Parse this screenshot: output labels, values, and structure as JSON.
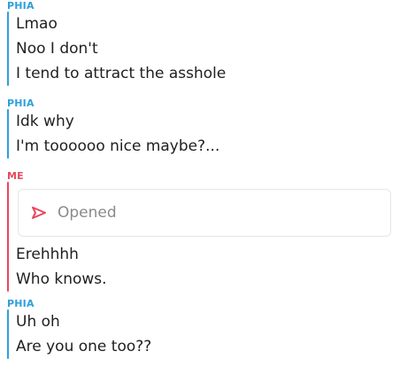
{
  "conversation": {
    "groups": [
      {
        "sender": "PHIA",
        "messages": [
          "Lmao",
          "Noo I don't",
          "I tend to attract the asshole"
        ]
      },
      {
        "sender": "PHIA",
        "messages": [
          "Idk why",
          "I'm toooooo nice maybe?..."
        ]
      },
      {
        "sender": "ME",
        "status": "Opened",
        "messages": [
          "Erehhhh",
          "Who knows."
        ]
      },
      {
        "sender": "PHIA",
        "messages": [
          "Uh oh",
          "Are you one too??"
        ]
      }
    ]
  },
  "colors": {
    "friend_accent": "#2ea0dc",
    "me_accent": "#e8485d",
    "status_text": "#8a8a8a"
  },
  "icons": {
    "opened_status": "opened-arrow-icon"
  }
}
